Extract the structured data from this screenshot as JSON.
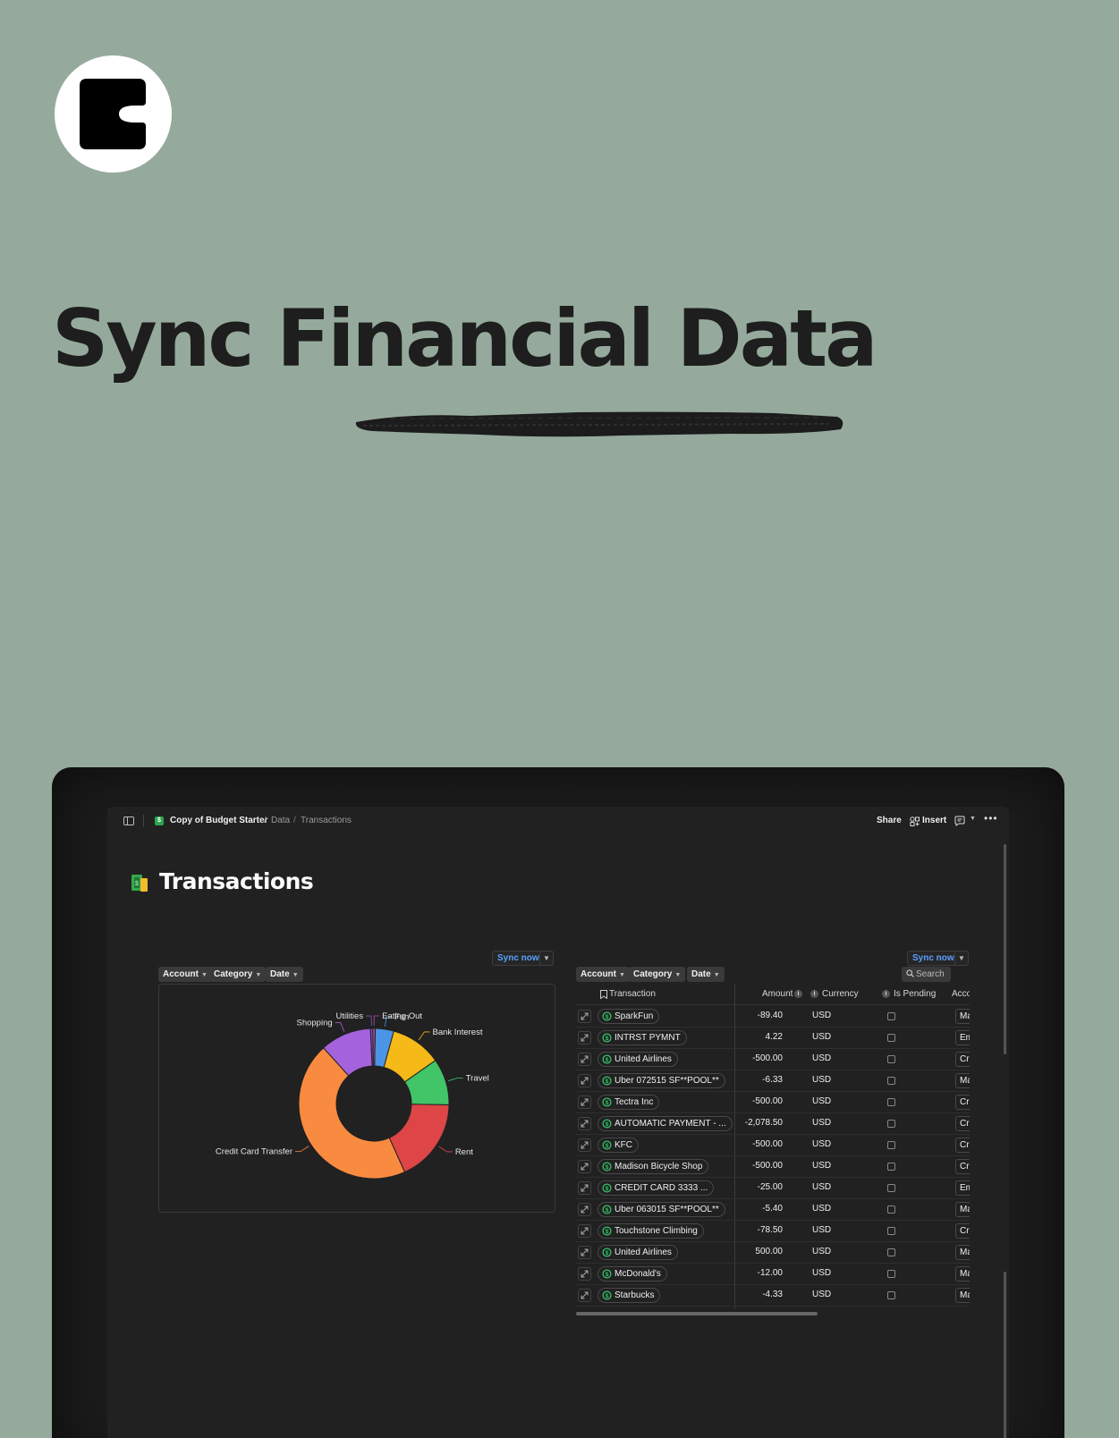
{
  "hero": {
    "title": "Sync Financial Data"
  },
  "app": {
    "breadcrumb": {
      "doc": "Copy of Budget Starter",
      "data": "Data",
      "page": "Transactions",
      "doc_icon": "$"
    },
    "toolbar": {
      "share": "Share",
      "insert": "Insert"
    },
    "page_title": "Transactions",
    "sync_label": "Sync now",
    "filters": {
      "account": "Account",
      "category": "Category",
      "date": "Date"
    },
    "search_placeholder": "Search",
    "info_glyph": "i",
    "table": {
      "columns": {
        "transaction": "Transaction",
        "amount": "Amount",
        "currency": "Currency",
        "is_pending": "Is Pending",
        "account": "Acco"
      },
      "rows": [
        {
          "name": "SparkFun",
          "amount": "-89.40",
          "currency": "USD",
          "account": "Ma"
        },
        {
          "name": "INTRST PYMNT",
          "amount": "4.22",
          "currency": "USD",
          "account": "Em"
        },
        {
          "name": "United Airlines",
          "amount": "-500.00",
          "currency": "USD",
          "account": "Cre"
        },
        {
          "name": "Uber 072515 SF**POOL**",
          "amount": "-6.33",
          "currency": "USD",
          "account": "Ma"
        },
        {
          "name": "Tectra Inc",
          "amount": "-500.00",
          "currency": "USD",
          "account": "Cre"
        },
        {
          "name": "AUTOMATIC PAYMENT - ...",
          "amount": "-2,078.50",
          "currency": "USD",
          "account": "Cre"
        },
        {
          "name": "KFC",
          "amount": "-500.00",
          "currency": "USD",
          "account": "Cre"
        },
        {
          "name": "Madison Bicycle Shop",
          "amount": "-500.00",
          "currency": "USD",
          "account": "Cre"
        },
        {
          "name": "CREDIT CARD 3333 ...",
          "amount": "-25.00",
          "currency": "USD",
          "account": "Em"
        },
        {
          "name": "Uber 063015 SF**POOL**",
          "amount": "-5.40",
          "currency": "USD",
          "account": "Ma"
        },
        {
          "name": "Touchstone Climbing",
          "amount": "-78.50",
          "currency": "USD",
          "account": "Cre"
        },
        {
          "name": "United Airlines",
          "amount": "500.00",
          "currency": "USD",
          "account": "Ma"
        },
        {
          "name": "McDonald's",
          "amount": "-12.00",
          "currency": "USD",
          "account": "Ma"
        },
        {
          "name": "Starbucks",
          "amount": "-4.33",
          "currency": "USD",
          "account": "Ma"
        }
      ]
    }
  },
  "chart_data": {
    "type": "pie",
    "donut": true,
    "categories": [
      "Fun",
      "Bank Interest",
      "Travel",
      "Rent",
      "Credit Card Transfer",
      "Shopping",
      "Utilities",
      "Eating Out"
    ],
    "values": [
      4,
      11,
      10,
      18,
      45,
      11,
      0.5,
      0.5
    ],
    "colors": [
      "#4c95e6",
      "#f5b918",
      "#42c468",
      "#de4546",
      "#f98b40",
      "#a462dc",
      "#7a52c9",
      "#c04a9c"
    ]
  }
}
